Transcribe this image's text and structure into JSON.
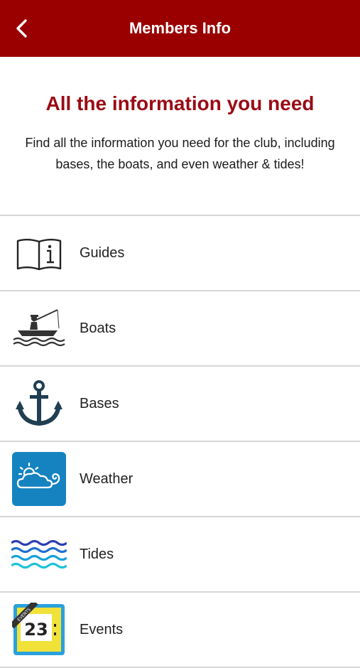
{
  "header": {
    "title": "Members Info",
    "back_icon": "chevron-left-icon"
  },
  "intro": {
    "heading": "All the information you need",
    "description": "Find all the information you need for the club, including bases, the boats, and even weather & tides!"
  },
  "menu": [
    {
      "label": "Guides",
      "icon": "info-book-icon"
    },
    {
      "label": "Boats",
      "icon": "fishing-boat-icon"
    },
    {
      "label": "Bases",
      "icon": "anchor-icon"
    },
    {
      "label": "Weather",
      "icon": "weather-cloud-sun-icon"
    },
    {
      "label": "Tides",
      "icon": "waves-icon"
    },
    {
      "label": "Events",
      "icon": "calendar-icon",
      "icon_text": "23",
      "icon_banner": "EVENTS"
    }
  ],
  "colors": {
    "header": "#9a0000",
    "heading": "#9a0a14",
    "weather_tile": "#1683c1"
  }
}
